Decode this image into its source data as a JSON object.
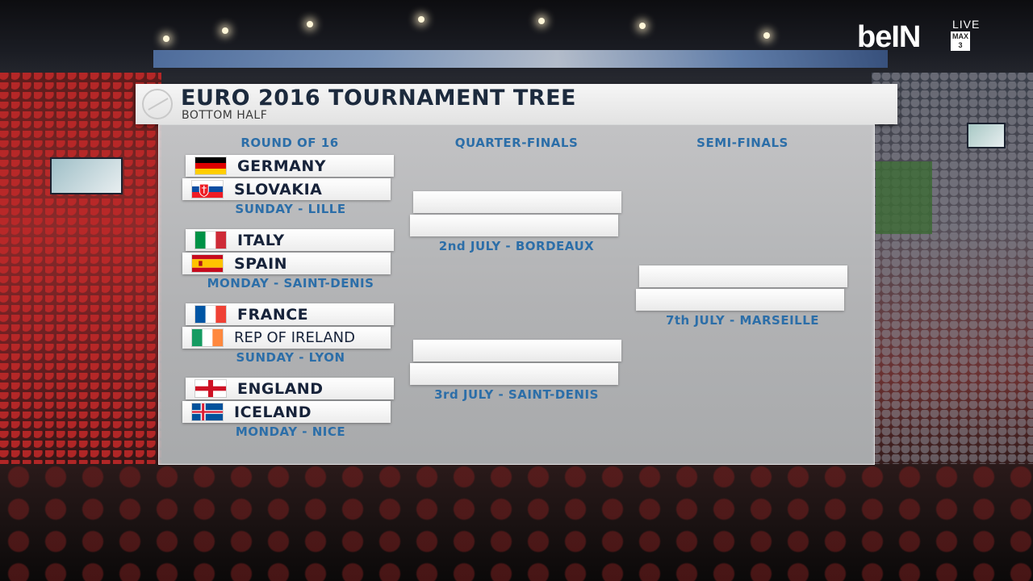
{
  "broadcaster": {
    "logo_text": "beIN",
    "live_label": "LIVE",
    "channel_label": "MAX 3"
  },
  "graphic": {
    "title": "EURO 2016 TOURNAMENT TREE",
    "subtitle": "BOTTOM HALF",
    "columns": {
      "round_of_16": "ROUND OF 16",
      "quarter_finals": "QUARTER-FINALS",
      "semi_finals": "SEMI-FINALS"
    },
    "matches": [
      {
        "home": "GERMANY",
        "away": "SLOVAKIA",
        "info": "SUNDAY - LILLE"
      },
      {
        "home": "ITALY",
        "away": "SPAIN",
        "info": "MONDAY - SAINT-DENIS"
      },
      {
        "home": "FRANCE",
        "away": "REP OF IRELAND",
        "info": "SUNDAY - LYON"
      },
      {
        "home": "ENGLAND",
        "away": "ICELAND",
        "info": "MONDAY - NICE"
      }
    ],
    "quarter_finals": [
      {
        "info": "2nd JULY - BORDEAUX"
      },
      {
        "info": "3rd JULY - SAINT-DENIS"
      }
    ],
    "semi_final": {
      "info": "7th JULY - MARSEILLE"
    }
  }
}
